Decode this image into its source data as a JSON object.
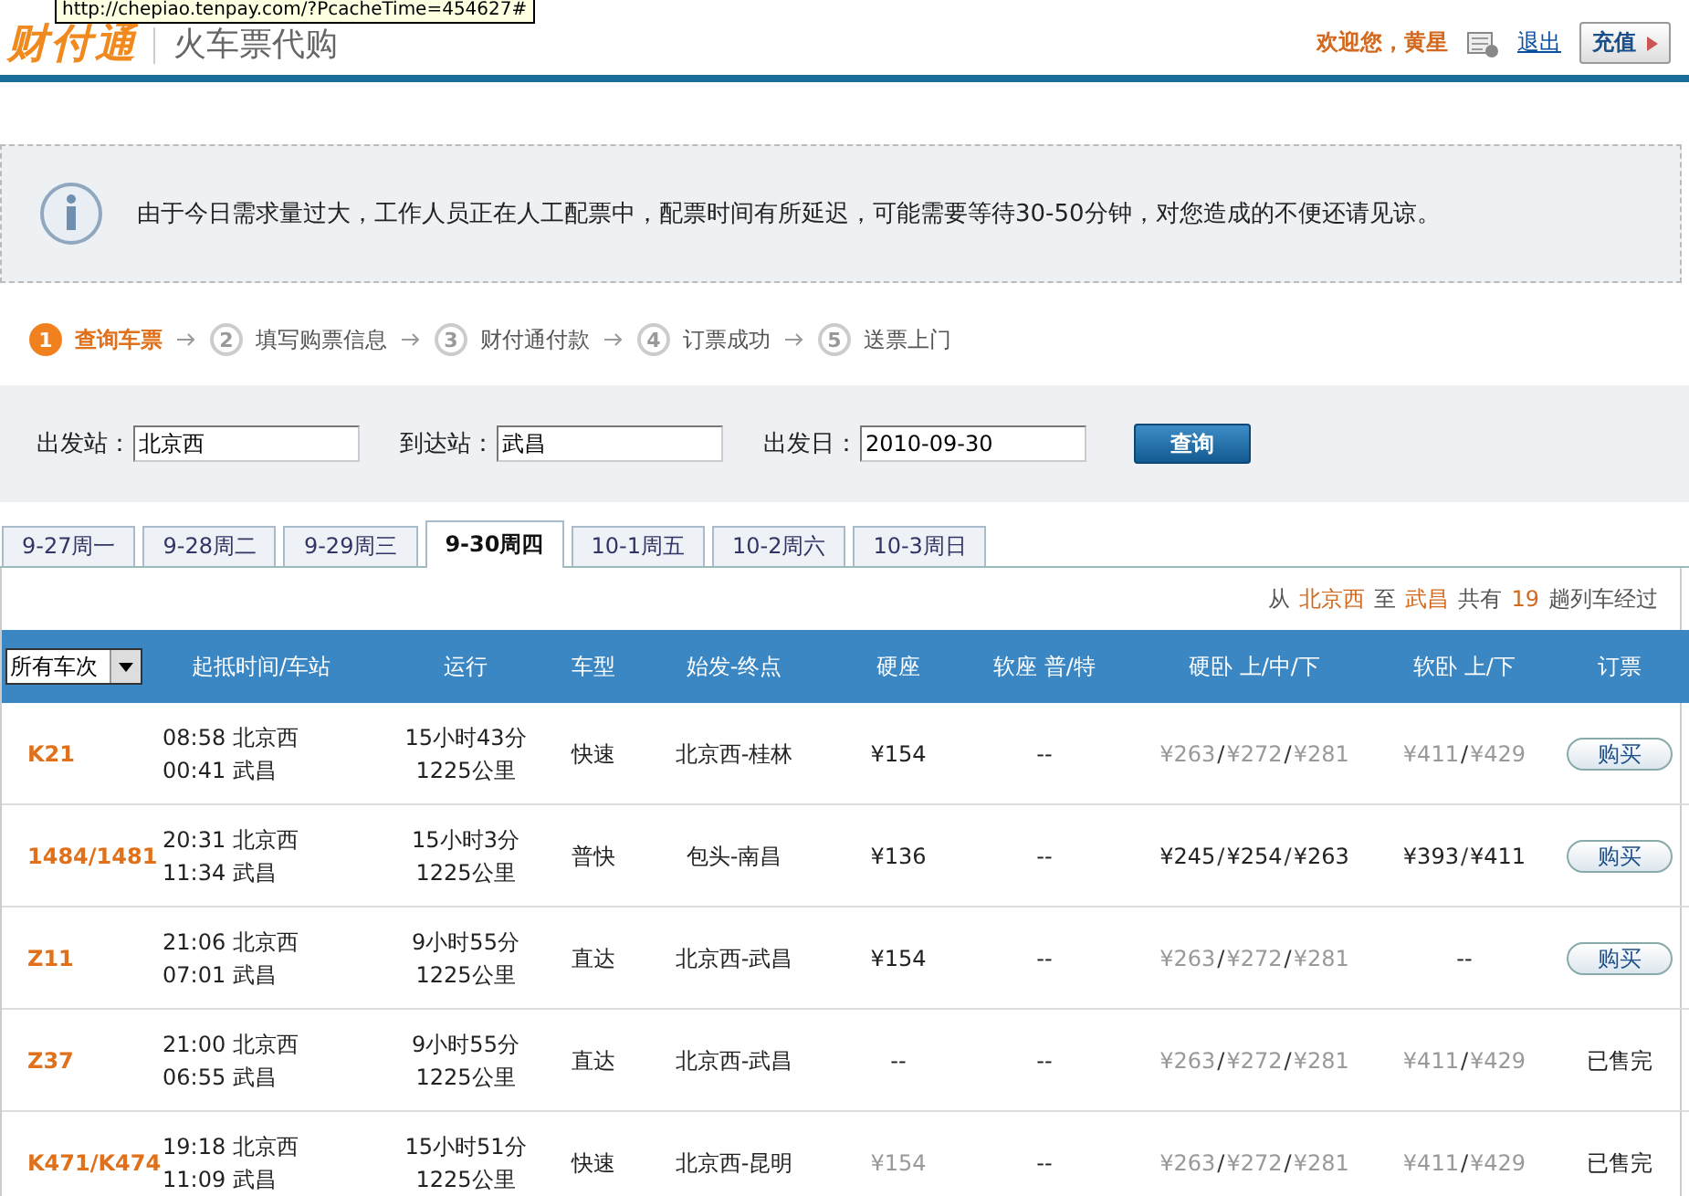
{
  "tooltip": "http://chepiao.tenpay.com/?PcacheTime=454627#",
  "header": {
    "logo": "财付通",
    "subtitle": "火车票代购",
    "welcome": "欢迎您，黄星",
    "logout": "退出",
    "recharge": "充值"
  },
  "notice": "由于今日需求量过大，工作人员正在人工配票中，配票时间有所延迟，可能需要等待30-50分钟，对您造成的不便还请见谅。",
  "steps": [
    {
      "num": "1",
      "label": "查询车票",
      "selected": true
    },
    {
      "num": "2",
      "label": "填写购票信息",
      "selected": false
    },
    {
      "num": "3",
      "label": "财付通付款",
      "selected": false
    },
    {
      "num": "4",
      "label": "订票成功",
      "selected": false
    },
    {
      "num": "5",
      "label": "送票上门",
      "selected": false
    }
  ],
  "search": {
    "fields": [
      {
        "label": "出发站：",
        "value": "北京西"
      },
      {
        "label": "到达站：",
        "value": "武昌"
      },
      {
        "label": "出发日：",
        "value": "2010-09-30"
      }
    ],
    "button": "查询"
  },
  "tabs": [
    {
      "label": "9-27周一",
      "selected": false
    },
    {
      "label": "9-28周二",
      "selected": false
    },
    {
      "label": "9-29周三",
      "selected": false
    },
    {
      "label": "9-30周四",
      "selected": true
    },
    {
      "label": "10-1周五",
      "selected": false
    },
    {
      "label": "10-2周六",
      "selected": false
    },
    {
      "label": "10-3周日",
      "selected": false
    }
  ],
  "summary": [
    {
      "text": "从",
      "highlight": false
    },
    {
      "text": "北京西",
      "highlight": true
    },
    {
      "text": "至",
      "highlight": false
    },
    {
      "text": "武昌",
      "highlight": true
    },
    {
      "text": "共有",
      "highlight": false
    },
    {
      "text": "19",
      "highlight": true
    },
    {
      "text": "趟列车经过",
      "highlight": false
    }
  ],
  "table": {
    "filter": "所有车次",
    "columns": [
      "起抵时间/车站",
      "运行",
      "车型",
      "始发-终点",
      "硬座",
      "软座 普/特",
      "硬卧 上/中/下",
      "软卧 上/下",
      "订票"
    ],
    "rows": [
      {
        "train": "K21",
        "depart": "08:58 北京西",
        "arrive": "00:41 武昌",
        "duration": "15小时43分",
        "distance": "1225公里",
        "type": "快速",
        "route": "北京西-桂林",
        "hard_seat": [
          {
            "kind": "price",
            "text": "¥154",
            "available": true
          }
        ],
        "soft_seat": [
          {
            "kind": "price",
            "text": "--",
            "available": true
          }
        ],
        "hard_sleeper": [
          {
            "kind": "price",
            "text": "¥263",
            "available": false
          },
          {
            "kind": "separator",
            "text": "/"
          },
          {
            "kind": "price",
            "text": "¥272",
            "available": false
          },
          {
            "kind": "separator",
            "text": "/"
          },
          {
            "kind": "price",
            "text": "¥281",
            "available": false
          }
        ],
        "soft_sleeper": [
          {
            "kind": "price",
            "text": "¥411",
            "available": false
          },
          {
            "kind": "separator",
            "text": "/"
          },
          {
            "kind": "price",
            "text": "¥429",
            "available": false
          }
        ],
        "order": {
          "kind": "button",
          "text": "购买"
        }
      },
      {
        "train": "1484/1481",
        "depart": "20:31 北京西",
        "arrive": "11:34 武昌",
        "duration": "15小时3分",
        "distance": "1225公里",
        "type": "普快",
        "route": "包头-南昌",
        "hard_seat": [
          {
            "kind": "price",
            "text": "¥136",
            "available": true
          }
        ],
        "soft_seat": [
          {
            "kind": "price",
            "text": "--",
            "available": true
          }
        ],
        "hard_sleeper": [
          {
            "kind": "price",
            "text": "¥245",
            "available": true
          },
          {
            "kind": "separator",
            "text": "/"
          },
          {
            "kind": "price",
            "text": "¥254",
            "available": true
          },
          {
            "kind": "separator",
            "text": "/"
          },
          {
            "kind": "price",
            "text": "¥263",
            "available": true
          }
        ],
        "soft_sleeper": [
          {
            "kind": "price",
            "text": "¥393",
            "available": true
          },
          {
            "kind": "separator",
            "text": "/"
          },
          {
            "kind": "price",
            "text": "¥411",
            "available": true
          }
        ],
        "order": {
          "kind": "button",
          "text": "购买"
        }
      },
      {
        "train": "Z11",
        "depart": "21:06 北京西",
        "arrive": "07:01 武昌",
        "duration": "9小时55分",
        "distance": "1225公里",
        "type": "直达",
        "route": "北京西-武昌",
        "hard_seat": [
          {
            "kind": "price",
            "text": "¥154",
            "available": true
          }
        ],
        "soft_seat": [
          {
            "kind": "price",
            "text": "--",
            "available": true
          }
        ],
        "hard_sleeper": [
          {
            "kind": "price",
            "text": "¥263",
            "available": false
          },
          {
            "kind": "separator",
            "text": "/"
          },
          {
            "kind": "price",
            "text": "¥272",
            "available": false
          },
          {
            "kind": "separator",
            "text": "/"
          },
          {
            "kind": "price",
            "text": "¥281",
            "available": false
          }
        ],
        "soft_sleeper": [
          {
            "kind": "price",
            "text": "--",
            "available": true
          }
        ],
        "order": {
          "kind": "button",
          "text": "购买"
        }
      },
      {
        "train": "Z37",
        "depart": "21:00 北京西",
        "arrive": "06:55 武昌",
        "duration": "9小时55分",
        "distance": "1225公里",
        "type": "直达",
        "route": "北京西-武昌",
        "hard_seat": [
          {
            "kind": "price",
            "text": "--",
            "available": true
          }
        ],
        "soft_seat": [
          {
            "kind": "price",
            "text": "--",
            "available": true
          }
        ],
        "hard_sleeper": [
          {
            "kind": "price",
            "text": "¥263",
            "available": false
          },
          {
            "kind": "separator",
            "text": "/"
          },
          {
            "kind": "price",
            "text": "¥272",
            "available": false
          },
          {
            "kind": "separator",
            "text": "/"
          },
          {
            "kind": "price",
            "text": "¥281",
            "available": false
          }
        ],
        "soft_sleeper": [
          {
            "kind": "price",
            "text": "¥411",
            "available": false
          },
          {
            "kind": "separator",
            "text": "/"
          },
          {
            "kind": "price",
            "text": "¥429",
            "available": false
          }
        ],
        "order": {
          "kind": "sold_out",
          "text": "已售完"
        }
      },
      {
        "train": "K471/K474",
        "depart": "19:18 北京西",
        "arrive": "11:09 武昌",
        "duration": "15小时51分",
        "distance": "1225公里",
        "type": "快速",
        "route": "北京西-昆明",
        "hard_seat": [
          {
            "kind": "price",
            "text": "¥154",
            "available": false
          }
        ],
        "soft_seat": [
          {
            "kind": "price",
            "text": "--",
            "available": true
          }
        ],
        "hard_sleeper": [
          {
            "kind": "price",
            "text": "¥263",
            "available": false
          },
          {
            "kind": "separator",
            "text": "/"
          },
          {
            "kind": "price",
            "text": "¥272",
            "available": false
          },
          {
            "kind": "separator",
            "text": "/"
          },
          {
            "kind": "price",
            "text": "¥281",
            "available": false
          }
        ],
        "soft_sleeper": [
          {
            "kind": "price",
            "text": "¥411",
            "available": false
          },
          {
            "kind": "separator",
            "text": "/"
          },
          {
            "kind": "price",
            "text": "¥429",
            "available": false
          }
        ],
        "order": {
          "kind": "sold_out",
          "text": "已售完"
        }
      }
    ]
  }
}
